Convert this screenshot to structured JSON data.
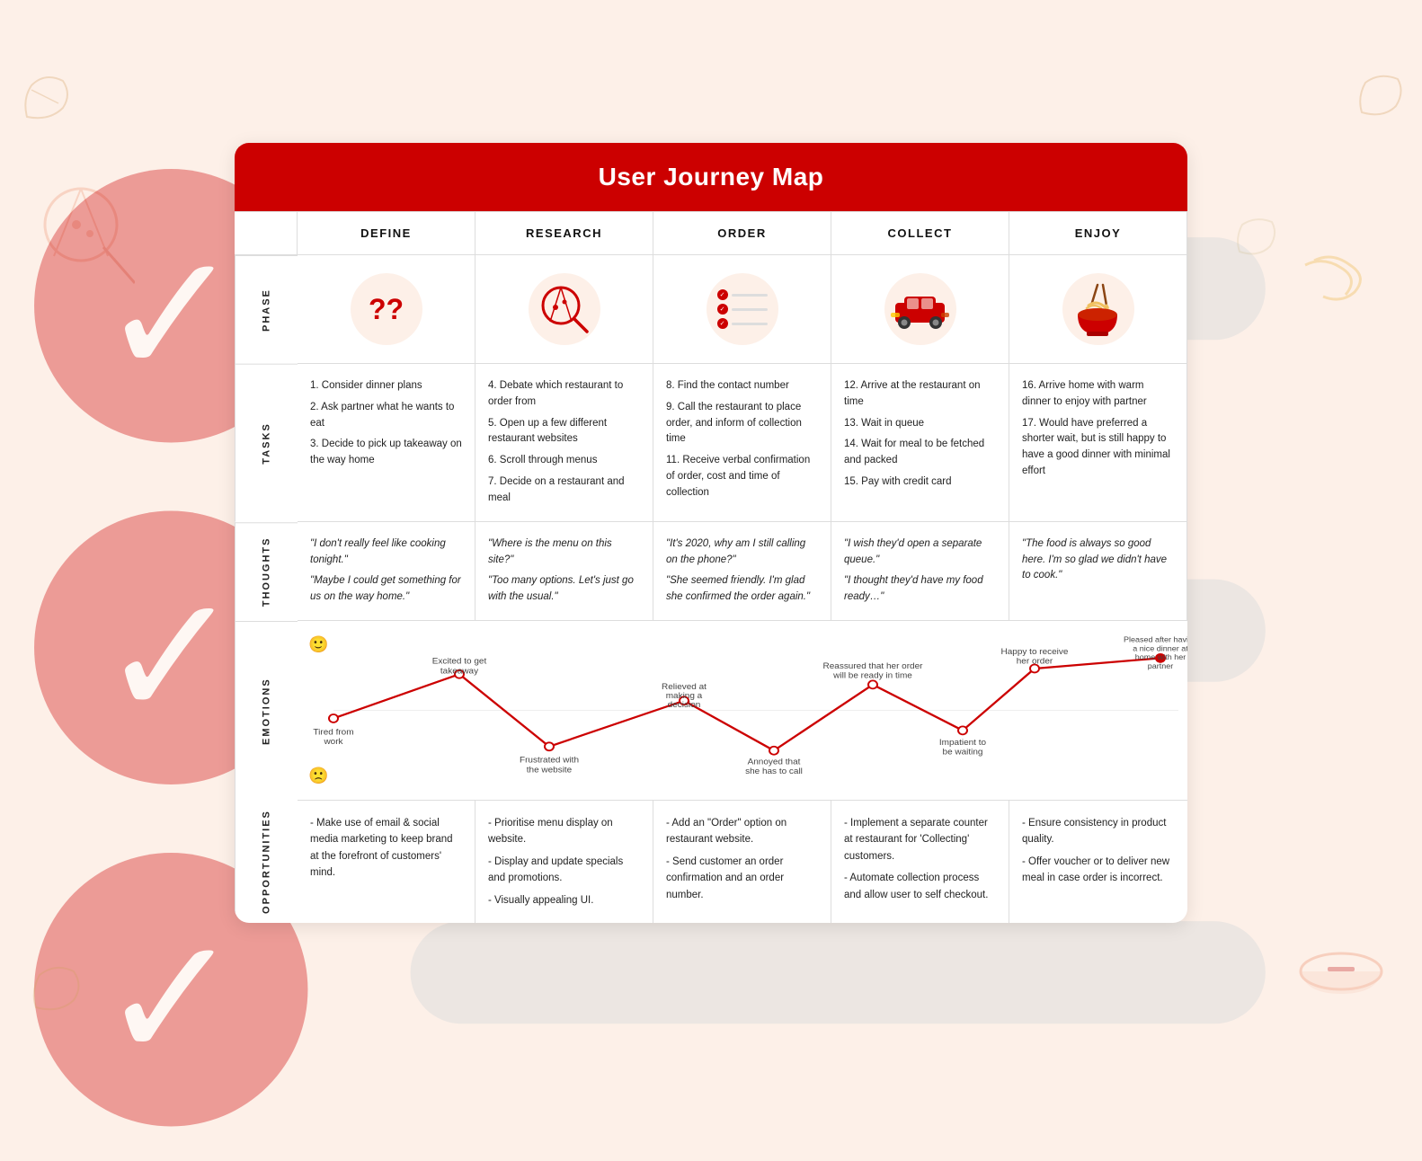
{
  "title": "User Journey Map",
  "columns": [
    "DEFINE",
    "RESEARCH",
    "ORDER",
    "COLLECT",
    "ENJOY"
  ],
  "row_labels": [
    "PHASE",
    "TASKS",
    "THOUGHTS",
    "EMOTIONS",
    "OPPORTUNITIES"
  ],
  "tasks": [
    "1. Consider dinner plans\n\n2. Ask partner what he wants to eat\n\n3. Decide to pick up takeaway on the way home",
    "4. Debate which restaurant to order from\n\n5. Open up a few different restaurant websites\n\n6. Scroll through menus\n\n7. Decide on a restaurant and meal",
    "8. Find the contact number\n\n9. Call the restaurant to place order, and inform of collection time\n\n11. Receive verbal confirmation of order, cost and time of collection",
    "12. Arrive at the restaurant on time\n\n13. Wait in queue\n\n14. Wait for meal to be fetched and packed\n\n15. Pay with credit card",
    "16. Arrive home with warm dinner to enjoy with partner\n\n17. Would have preferred a shorter wait, but is still happy to have a good dinner with minimal effort"
  ],
  "thoughts": [
    "“I don’t really feel like cooking tonight.”\n\n“Maybe I could get something for us on the way home.”",
    "“Where is the menu on this site?”\n\n“Too many options. Let’s just go with the usual.”",
    "“It’s 2020, why am I still calling on the phone?”\n\n“She seemed friendly. I’m glad she confirmed the order again.”",
    "“I wish they’d open a separate queue.”\n\n“I thought they’d have my food ready…”",
    "“The food is always so good here. I’m so glad we didn’t have to cook.”"
  ],
  "opportunities": [
    "- Make use of email & social media marketing to keep brand at the forefront of customers’ mind.",
    "- Prioritise menu display on website.\n\n- Display and update specials and promotions.\n\n- Visually appealing UI.",
    "- Add an “Order” option on restaurant website.\n\n- Send customer an order confirmation and an order number.",
    "- Implement a separate counter at restaurant for ‘Collecting’ customers.\n\n- Automate collection process and allow user to self checkout.",
    "- Ensure consistency in product quality.\n\n- Offer voucher or to deliver new meal in case order is incorrect."
  ],
  "emotion_points": [
    {
      "x": 0,
      "y": 0.55,
      "label": "Tired from\nwork",
      "label_pos": "below"
    },
    {
      "x": 1,
      "y": 0.25,
      "label": "Excited to get\ntakeaway",
      "label_pos": "above"
    },
    {
      "x": 1.5,
      "y": 0.72,
      "label": "Frustrated with\nthe website",
      "label_pos": "below"
    },
    {
      "x": 2,
      "y": 0.42,
      "label": "Relieved at\nmaking a\ndecision",
      "label_pos": "above"
    },
    {
      "x": 2.5,
      "y": 0.75,
      "label": "Annoyed that\nshe has to call",
      "label_pos": "below"
    },
    {
      "x": 3,
      "y": 0.32,
      "label": "Reassured that her order\nwill be ready in time",
      "label_pos": "above"
    },
    {
      "x": 3.7,
      "y": 0.62,
      "label": "Impatient to\nbe waiting",
      "label_pos": "below"
    },
    {
      "x": 4,
      "y": 0.22,
      "label": "Happy to receive\nher order",
      "label_pos": "above"
    },
    {
      "x": 5,
      "y": 0.15,
      "label": "Pleased after having\na nice dinner at\nhome with her\npartner",
      "label_pos": "above"
    }
  ]
}
